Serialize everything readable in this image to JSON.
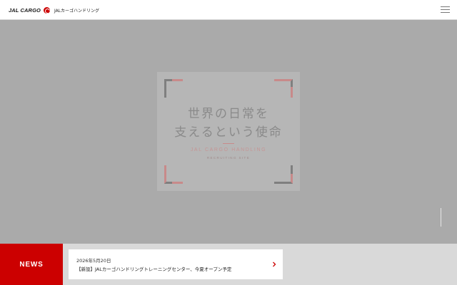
{
  "header": {
    "logo_wordmark": "JAL CARGO",
    "logo_subtitle": "JALカーゴハンドリング",
    "menu_icon": "hamburger-menu-icon",
    "brand_color": "#cc0000"
  },
  "hero": {
    "tagline_line1": "世界の日常を",
    "tagline_line2": "支えるという使命",
    "subtitle": "JAL CARGO HANDLING",
    "subsubtitle": "RECRUITING SITE",
    "accent_color": "#c88a8a"
  },
  "news": {
    "label": "NEWS",
    "label_color": "#cc0000",
    "items": [
      {
        "date": "2026年5月20日",
        "title": "【新設】JALカーゴハンドリングトレーニングセンター、今夏オープン予定",
        "icon": "chevron-right-icon"
      }
    ]
  }
}
